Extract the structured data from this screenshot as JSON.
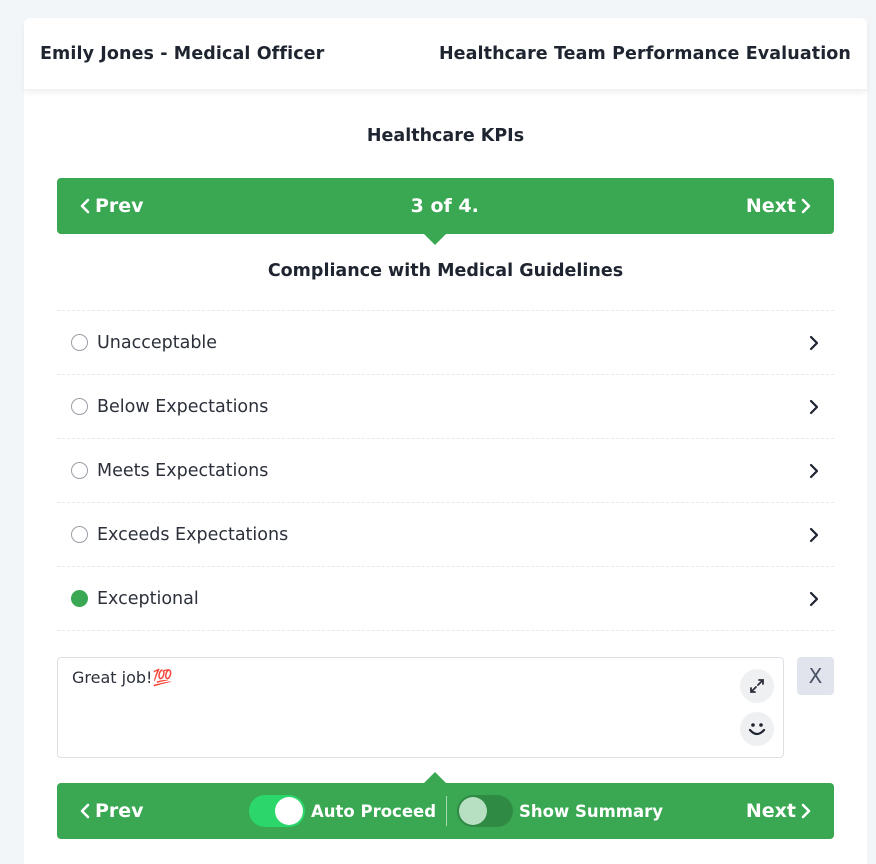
{
  "header": {
    "left_title": "Emily Jones - Medical Officer",
    "right_title": "Healthcare Team Performance Evaluation"
  },
  "section": {
    "title": "Healthcare KPIs"
  },
  "nav_top": {
    "prev_label": "Prev",
    "counter": "3 of 4.",
    "next_label": "Next"
  },
  "question": {
    "title": "Compliance with Medical Guidelines"
  },
  "options": [
    {
      "label": "Unacceptable",
      "selected": false
    },
    {
      "label": "Below Expectations",
      "selected": false
    },
    {
      "label": "Meets Expectations",
      "selected": false
    },
    {
      "label": "Exceeds Expectations",
      "selected": false
    },
    {
      "label": "Exceptional",
      "selected": true
    }
  ],
  "comment": {
    "value": "Great job!💯",
    "clear_label": "X"
  },
  "nav_bottom": {
    "prev_label": "Prev",
    "next_label": "Next",
    "auto_proceed_label": "Auto Proceed",
    "auto_proceed_on": true,
    "show_summary_label": "Show Summary",
    "show_summary_on": false
  },
  "colors": {
    "accent": "#3aa853",
    "toggle_on": "#2bd66b",
    "background": "#f3f6f9"
  },
  "icons": {
    "prev": "chevron-left-icon",
    "next": "chevron-right-icon",
    "option": "chevron-right-icon",
    "expand": "expand-icon",
    "emoji": "smiley-icon"
  }
}
